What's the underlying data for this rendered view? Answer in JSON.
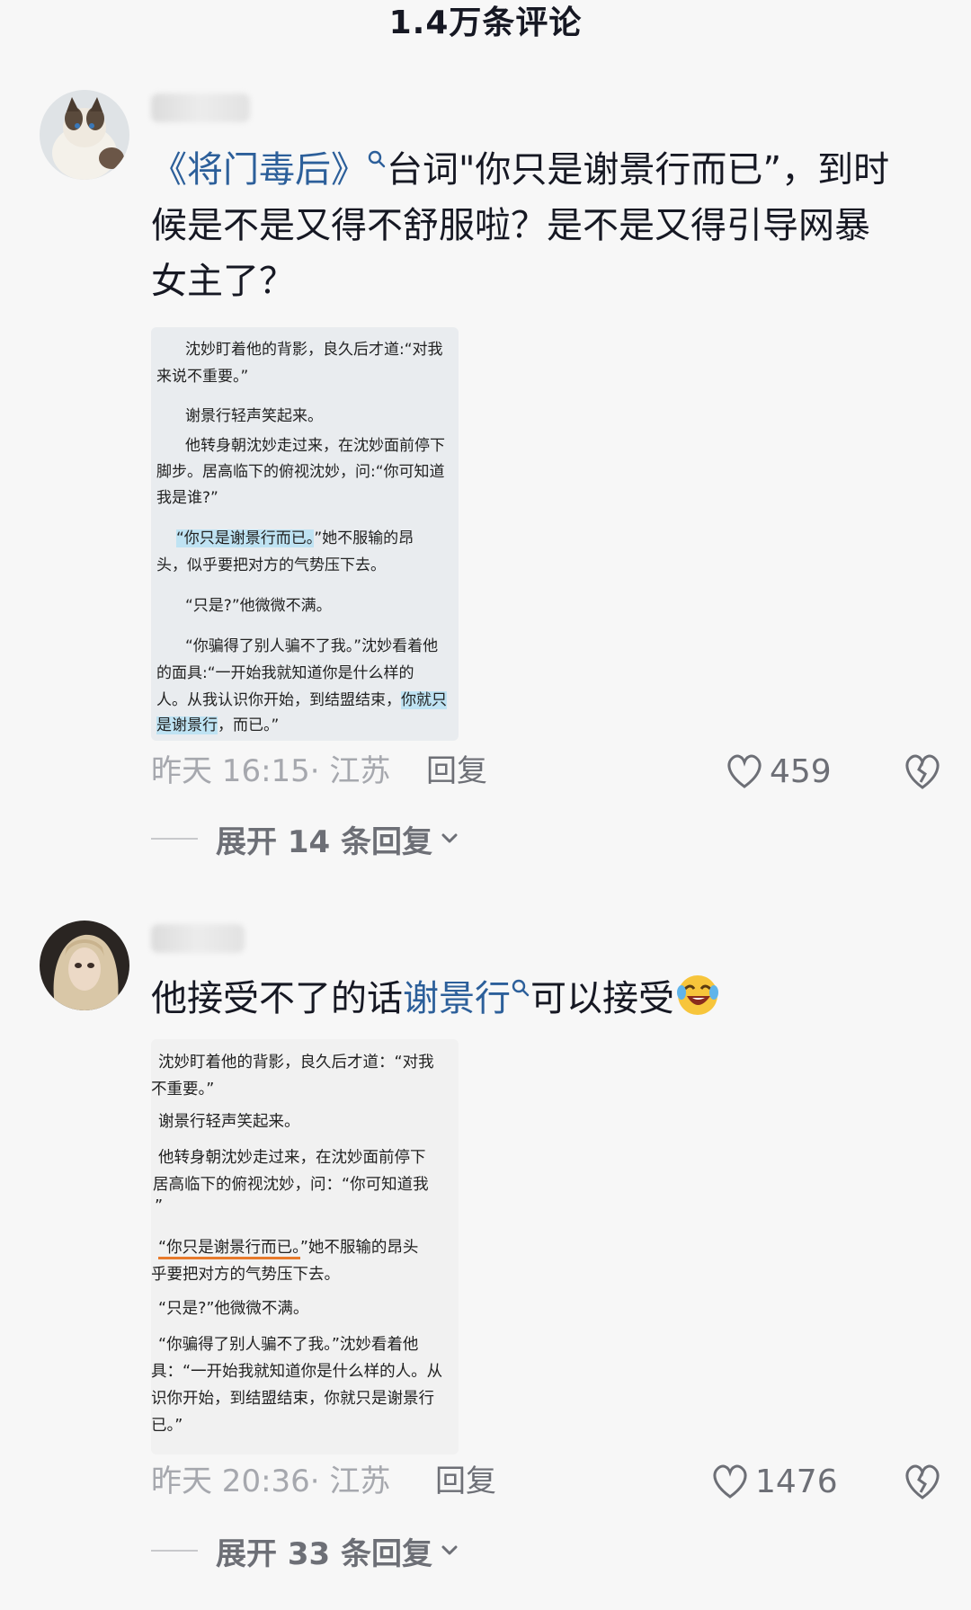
{
  "header": {
    "title": "1.4万条评论"
  },
  "comments": [
    {
      "link_text": "《将门毒后》",
      "text_parts": [
        "台词\"你只是谢景行而已”，到时",
        "候是不是又得不舒服啦？是不是又得引导网暴",
        "女主了？"
      ],
      "quote_lines": [
        "沈妙盯着他的背影，良久后才道:“对我",
        "来说不重要。”",
        "谢景行轻声笑起来。",
        "他转身朝沈妙走过来，在沈妙面前停下",
        "脚步。居高临下的俯视沈妙，问:“你可知道",
        "我是谁?”",
        "“你只是谢景行而已。",
        "”她不服输的昂",
        "头，似乎要把对方的气势压下去。",
        "“只是?”他微微不满。",
        "“你骗得了别人骗不了我。”沈妙看着他",
        "的面具:“一开始我就知道你是什么样的",
        "人。从我认识你开始，到结盟结束，",
        "你就只",
        "是谢景行",
        "，而已。”"
      ],
      "time": "昨天 16:15· 江苏",
      "reply_label": "回复",
      "likes": "459",
      "expand": "展开 14 条回复"
    },
    {
      "text_before": "他接受不了的话",
      "link_text": "谢景行",
      "text_after": "可以接受",
      "emoji": "laughing-crying-emoji",
      "quote_lines": [
        "沈妙盯着他的背影，良久后才道：“对我",
        "不重要。”",
        "谢景行轻声笑起来。",
        "他转身朝沈妙走过来，在沈妙面前停下",
        "居高临下的俯视沈妙，问：“你可知道我",
        "”",
        "“你只是谢景行而已。",
        "”她不服输的昂头",
        "乎要把对方的气势压下去。",
        "“只是?”他微微不满。",
        "“你骗得了别人骗不了我。”沈妙看着他",
        "具：“一开始我就知道你是什么样的人。从",
        "识你开始，到结盟结束，你就只是谢景行",
        "已。”"
      ],
      "time": "昨天 20:36· 江苏",
      "reply_label": "回复",
      "likes": "1476",
      "expand": "展开 33 条回复"
    }
  ],
  "colors": {
    "link": "#2c5f9a",
    "highlight": "#bfe3f3",
    "underline": "#e87a2b"
  }
}
